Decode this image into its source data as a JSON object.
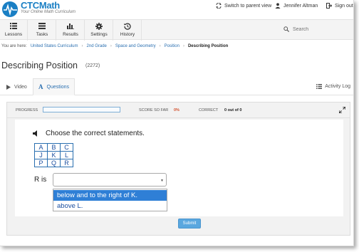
{
  "brand": {
    "name": "CTCMath",
    "tagline": "Your Online Math Curriculum"
  },
  "top_links": {
    "switch_parent": "Switch to parent view",
    "user_name": "Jennifer Altman",
    "sign_out": "Sign out"
  },
  "nav": {
    "items": [
      {
        "label": "Lessons",
        "icon": "list-icon"
      },
      {
        "label": "Tasks",
        "icon": "tasks-icon"
      },
      {
        "label": "Results",
        "icon": "bar-chart-icon"
      },
      {
        "label": "Settings",
        "icon": "gear-icon"
      },
      {
        "label": "History",
        "icon": "history-icon"
      }
    ],
    "search_placeholder": "Search"
  },
  "breadcrumb": {
    "prefix": "You are here:",
    "items": [
      "United States Curriculum",
      "2nd Grade",
      "Space and Geometry",
      "Position"
    ],
    "current": "Describing Position"
  },
  "page": {
    "title": "Describing Position",
    "id": "(2272)"
  },
  "tabs": {
    "video": "Video",
    "questions": "Questions",
    "activity_log": "Activity Log"
  },
  "status": {
    "progress_label": "PROGRESS",
    "progress_value": 0,
    "score_label": "SCORE SO FAR",
    "score_value": "0%",
    "correct_label": "CORRECT",
    "correct_value": "0 out of 0"
  },
  "question": {
    "prompt": "Choose the correct statements.",
    "grid": [
      [
        "A",
        "B",
        "C"
      ],
      [
        "J",
        "K",
        "L"
      ],
      [
        "P",
        "Q",
        "R"
      ]
    ],
    "answer_label": "R is",
    "dropdown_value": "",
    "options": [
      "below and to the right of K.",
      "above L."
    ],
    "highlighted_option": 0
  },
  "submit_label": "Submit",
  "colors": {
    "brand_blue": "#1a7fc4",
    "link_blue": "#2a6fb0",
    "score_red": "#d2502d",
    "highlight_blue": "#2f7fd6",
    "submit_blue": "#5aa7df"
  }
}
